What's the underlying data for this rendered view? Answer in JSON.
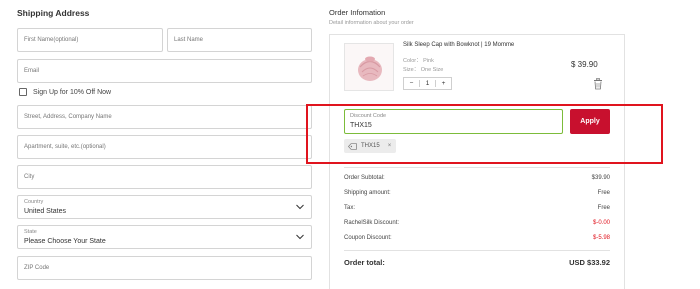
{
  "shipping": {
    "title": "Shipping Address",
    "first_name_placeholder": "First Name(optional)",
    "last_name_placeholder": "Last Name",
    "email_placeholder": "Email",
    "signup_label": "Sign Up for 10% Off Now",
    "street_placeholder": "Street, Address, Company Name",
    "apartment_placeholder": "Apartment, suite, etc.(optional)",
    "city_placeholder": "City",
    "country": {
      "label": "Country",
      "value": "United States"
    },
    "state": {
      "label": "State",
      "value": "Please Choose Your State"
    },
    "zip_placeholder": "ZIP Code"
  },
  "order": {
    "title": "Order Infomation",
    "subtitle": "Detail information about your order",
    "product": {
      "name": "Silk Sleep Cap with Bowknot | 19 Momme",
      "color": "Color： Pink",
      "size": "Size： One Size",
      "quantity": "1",
      "minus": "−",
      "plus": "+",
      "price": "$ 39.90"
    },
    "discount": {
      "label": "Discount Code",
      "value": "THX15",
      "apply_label": "Apply",
      "applied_code": "THX15",
      "remove_symbol": "×"
    },
    "summary": [
      {
        "label": "Order Subtotal:",
        "value": "$39.90"
      },
      {
        "label": "Shipping amount:",
        "value": "Free"
      },
      {
        "label": "Tax:",
        "value": "Free"
      },
      {
        "label": "RachelSilk Discount:",
        "value": "$-0.00"
      },
      {
        "label": "Coupon Discount:",
        "value": "$-5.98"
      }
    ],
    "total_label": "Order total:",
    "total_value": "USD $33.92"
  },
  "colors": {
    "accent_red": "#c8102e",
    "highlight_red": "#e0141e",
    "input_focus_green": "#7cbc3a"
  },
  "icons": {
    "chevron": "chevron-down-icon",
    "trash": "trash-icon",
    "tag": "tag-icon"
  }
}
